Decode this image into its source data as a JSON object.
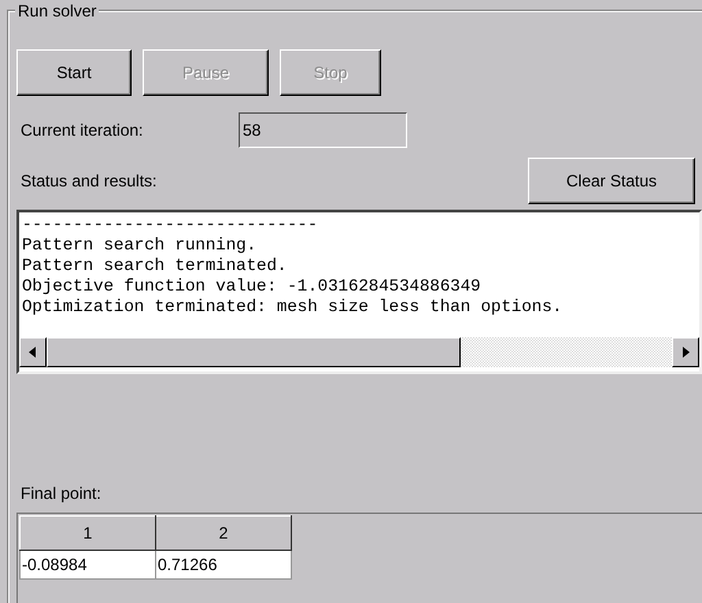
{
  "group": {
    "title": "Run solver"
  },
  "buttons": [
    {
      "label": "Start",
      "disabled": false
    },
    {
      "label": "Pause",
      "disabled": true
    },
    {
      "label": "Stop",
      "disabled": true
    }
  ],
  "iteration": {
    "label": "Current iteration:",
    "value": "58"
  },
  "status": {
    "label": "Status and results:",
    "clear_button": "Clear Status",
    "lines": [
      "-----------------------------",
      "Pattern search running.",
      "Pattern search terminated.",
      "Objective function value: -1.0316284534886349",
      "Optimization terminated: mesh size less than options."
    ]
  },
  "final_point": {
    "label": "Final point:",
    "columns": [
      "1",
      "2"
    ],
    "rows": [
      [
        "-0.08984",
        "0.71266"
      ]
    ]
  }
}
